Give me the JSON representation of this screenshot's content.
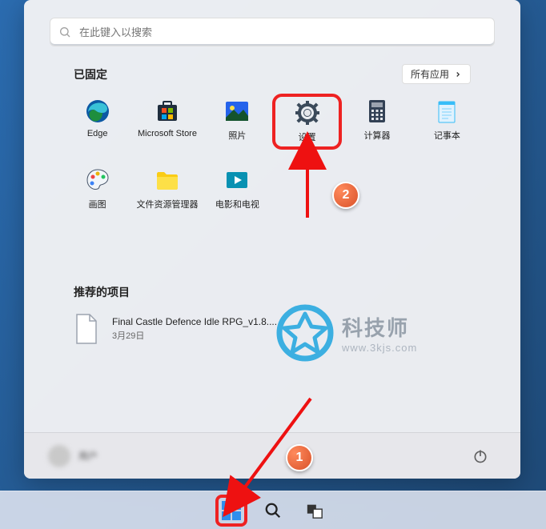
{
  "search": {
    "placeholder": "在此键入以搜索"
  },
  "pinned": {
    "title": "已固定",
    "all_apps_label": "所有应用",
    "apps": [
      {
        "label": "Edge"
      },
      {
        "label": "Microsoft Store"
      },
      {
        "label": "照片"
      },
      {
        "label": "设置"
      },
      {
        "label": "计算器"
      },
      {
        "label": "记事本"
      },
      {
        "label": "画图"
      },
      {
        "label": "文件资源管理器"
      },
      {
        "label": "电影和电视"
      }
    ]
  },
  "recommended": {
    "title": "推荐的项目",
    "items": [
      {
        "name": "Final Castle Defence Idle RPG_v1.8....",
        "date": "3月29日"
      }
    ]
  },
  "user": {
    "name": "用户"
  },
  "annotations": {
    "step1": "1",
    "step2": "2"
  },
  "watermark": {
    "line1": "科技师",
    "line2": "www.3kjs.com"
  }
}
